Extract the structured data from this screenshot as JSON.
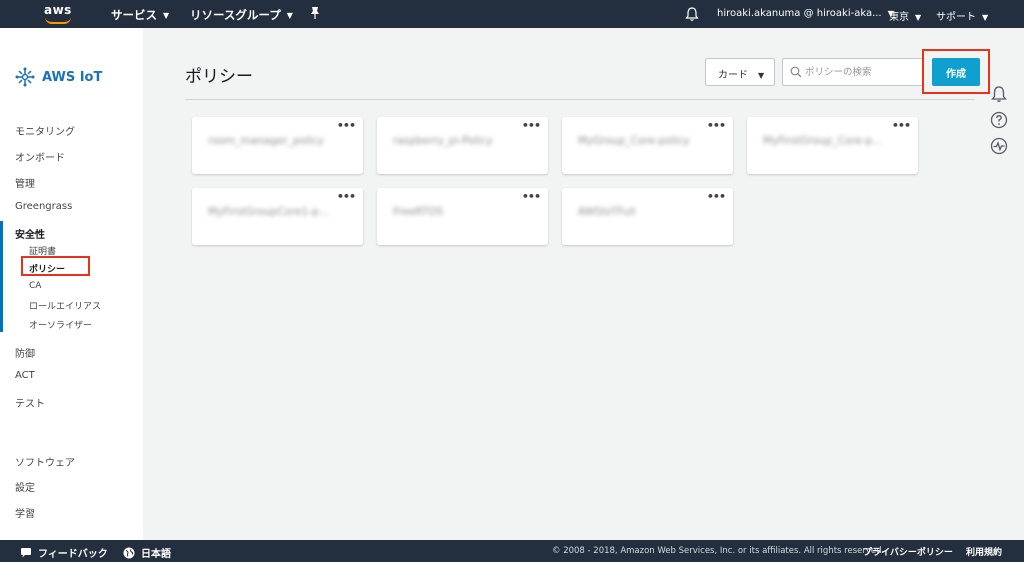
{
  "topnav": {
    "logo_text": "aws",
    "services": "サービス",
    "resource_groups": "リソースグループ",
    "account": "hiroaki.akanuma @ hiroaki-aka...",
    "region": "東京",
    "support": "サポート"
  },
  "sidebar": {
    "brand": "AWS IoT",
    "items": {
      "monitoring": "モニタリング",
      "onboard": "オンボード",
      "manage": "管理",
      "greengrass": "Greengrass",
      "secure": "安全性",
      "defend": "防御",
      "act": "ACT",
      "test": "テスト",
      "software": "ソフトウェア",
      "settings": "設定",
      "learn": "学習"
    },
    "secure_sub": {
      "certificates": "証明書",
      "policies": "ポリシー",
      "ca": "CA",
      "role_aliases": "ロールエイリアス",
      "authorizers": "オーソライザー"
    }
  },
  "main": {
    "title": "ポリシー",
    "view_select": "カード",
    "search_placeholder": "ポリシーの検索",
    "create_label": "作成",
    "card_menu": "•••",
    "cards": [
      "room_manager_policy",
      "raspberry_pi-Policy",
      "MyGroup_Core-policy",
      "MyFirstGroup_Core-p...",
      "MyFirstGroupCore1-p...",
      "FreeRTOS",
      "AWSIoTFull"
    ]
  },
  "footer": {
    "feedback": "フィードバック",
    "language": "日本語",
    "copyright": "© 2008 - 2018, Amazon Web Services, Inc. or its affiliates. All rights reserved.",
    "privacy": "プライバシーポリシー",
    "terms": "利用規約"
  },
  "colors": {
    "nav_bg": "#232f3e",
    "accent": "#0fa0d0",
    "highlight": "#e8331c",
    "brand_blue": "#1a73b5"
  }
}
